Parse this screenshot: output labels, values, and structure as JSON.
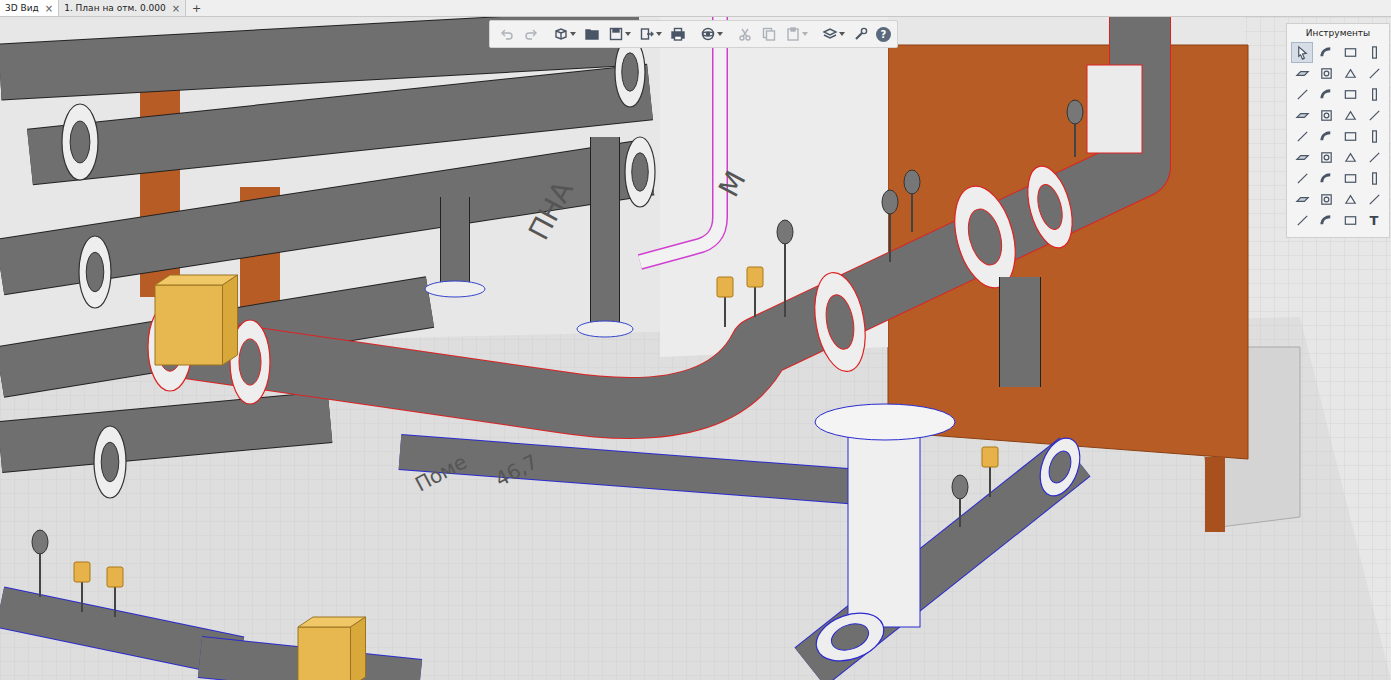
{
  "tabs": [
    {
      "label": "3D Вид",
      "selected": true,
      "close": "×"
    },
    {
      "label": "1. План на отм. 0.000",
      "selected": false,
      "close": "×"
    }
  ],
  "new_tab": "+",
  "toolbar": {
    "buttons": [
      {
        "kind": "undo",
        "disabled": true,
        "dropdown": false,
        "group_end": false
      },
      {
        "kind": "redo",
        "disabled": true,
        "dropdown": false,
        "group_end": true
      },
      {
        "kind": "cube",
        "disabled": false,
        "dropdown": true,
        "group_end": false
      },
      {
        "kind": "folder",
        "disabled": false,
        "dropdown": false,
        "group_end": false
      },
      {
        "kind": "save",
        "disabled": false,
        "dropdown": true,
        "group_end": false
      },
      {
        "kind": "export",
        "disabled": false,
        "dropdown": true,
        "group_end": false
      },
      {
        "kind": "print",
        "disabled": false,
        "dropdown": false,
        "group_end": true
      },
      {
        "kind": "orbit",
        "disabled": false,
        "dropdown": true,
        "group_end": true
      },
      {
        "kind": "cut",
        "disabled": true,
        "dropdown": false,
        "group_end": false
      },
      {
        "kind": "copy",
        "disabled": true,
        "dropdown": false,
        "group_end": false
      },
      {
        "kind": "paste",
        "disabled": true,
        "dropdown": true,
        "group_end": true
      },
      {
        "kind": "views",
        "disabled": false,
        "dropdown": true,
        "group_end": false
      },
      {
        "kind": "wrench",
        "disabled": false,
        "dropdown": false,
        "group_end": false
      }
    ],
    "help": "?"
  },
  "tools_panel": {
    "title": "Инструменты",
    "tools": [
      {
        "selected": true
      },
      {
        "selected": false
      },
      {
        "selected": false
      },
      {
        "selected": false
      },
      {
        "selected": false
      },
      {
        "selected": false
      },
      {
        "selected": false
      },
      {
        "selected": false
      },
      {
        "selected": false
      },
      {
        "selected": false
      },
      {
        "selected": false
      },
      {
        "selected": false
      },
      {
        "selected": false
      },
      {
        "selected": false
      },
      {
        "selected": false
      },
      {
        "selected": false
      },
      {
        "selected": false
      },
      {
        "selected": false
      },
      {
        "selected": false
      },
      {
        "selected": false
      },
      {
        "selected": false
      },
      {
        "selected": false
      },
      {
        "selected": false
      },
      {
        "selected": false
      },
      {
        "selected": false
      },
      {
        "selected": false
      },
      {
        "selected": false
      },
      {
        "selected": false
      },
      {
        "selected": false
      },
      {
        "selected": false
      },
      {
        "selected": false
      },
      {
        "selected": false
      },
      {
        "selected": false
      },
      {
        "selected": false
      },
      {
        "selected": false
      },
      {
        "selected": false,
        "label": "T"
      }
    ]
  },
  "scene": {
    "labels": [
      {
        "text": "Поме"
      },
      {
        "text": "46,7"
      },
      {
        "text": "ПНА"
      },
      {
        "text": "М"
      }
    ]
  }
}
